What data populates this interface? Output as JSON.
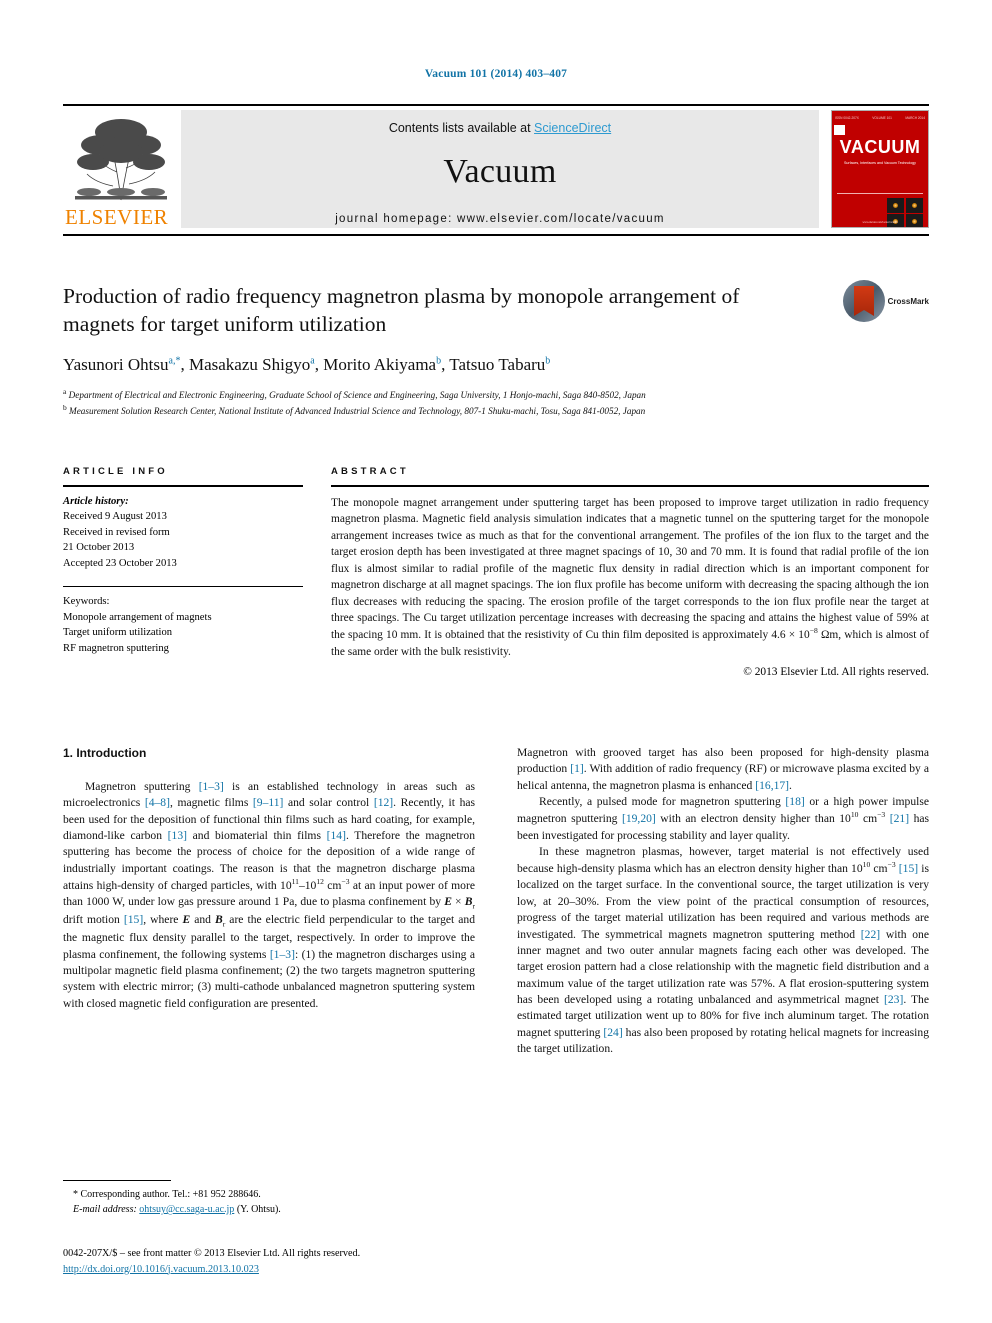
{
  "running_head": "Vacuum 101 (2014) 403–407",
  "masthead": {
    "contents_prefix": "Contents lists available at ",
    "sciencedirect": "ScienceDirect",
    "journal_name": "Vacuum",
    "homepage": "journal homepage: www.elsevier.com/locate/vacuum",
    "publisher_logo_text": "ELSEVIER",
    "cover": {
      "title": "VACUUM",
      "subtitle": "Surfaces, Interfaces and Vacuum Technology",
      "top_left": "ISSN 0042-207X",
      "top_mid": "VOLUME 101",
      "top_right": "MARCH 2014",
      "bottom": "www.elsevier.com/locate/vacuum"
    }
  },
  "article": {
    "title": "Production of radio frequency magnetron plasma by monopole arrangement of magnets for target uniform utilization",
    "crossmark_label": "CrossMark",
    "authors_html": "Yasunori Ohtsu<sup>a,*</sup>, Masakazu Shigyo<sup>a</sup>, Morito Akiyama<sup>b</sup>, Tatsuo Tabaru<sup>b</sup>",
    "affiliation_a": "Department of Electrical and Electronic Engineering, Graduate School of Science and Engineering, Saga University, 1 Honjo-machi, Saga 840-8502, Japan",
    "affiliation_b": "Measurement Solution Research Center, National Institute of Advanced Industrial Science and Technology, 807-1 Shuku-machi, Tosu, Saga 841-0052, Japan"
  },
  "article_info": {
    "heading": "ARTICLE INFO",
    "history_label": "Article history:",
    "received": "Received 9 August 2013",
    "revised_label": "Received in revised form",
    "revised_date": "21 October 2013",
    "accepted": "Accepted 23 October 2013",
    "keywords_label": "Keywords:",
    "keywords": [
      "Monopole arrangement of magnets",
      "Target uniform utilization",
      "RF magnetron sputtering"
    ]
  },
  "abstract": {
    "heading": "ABSTRACT",
    "text_html": "The monopole magnet arrangement under sputtering target has been proposed to improve target utilization in radio frequency magnetron plasma. Magnetic field analysis simulation indicates that a magnetic tunnel on the sputtering target for the monopole arrangement increases twice as much as that for the conventional arrangement. The profiles of the ion flux to the target and the target erosion depth has been investigated at three magnet spacings of 10, 30 and 70 mm. It is found that radial profile of the ion flux is almost similar to radial profile of the magnetic flux density in radial direction which is an important component for magnetron discharge at all magnet spacings. The ion flux profile has become uniform with decreasing the spacing although the ion flux decreases with reducing the spacing. The erosion profile of the target corresponds to the ion flux profile near the target at three spacings. The Cu target utilization percentage increases with decreasing the spacing and attains the highest value of 59% at the spacing 10 mm. It is obtained that the resistivity of Cu thin film deposited is approximately 4.6 &times; 10<sup class=\"sm\">&minus;8</sup> &Omega;m, which is almost of the same order with the bulk resistivity.",
    "copyright": "© 2013 Elsevier Ltd. All rights reserved."
  },
  "body": {
    "section_title": "1. Introduction",
    "left_paragraphs_html": [
      "Magnetron sputtering <span class=\"ref\">[1&ndash;3]</span> is an established technology in areas such as microelectronics <span class=\"ref\">[4&ndash;8]</span>, magnetic films <span class=\"ref\">[9&ndash;11]</span> and solar control <span class=\"ref\">[12]</span>. Recently, it has been used for the deposition of functional thin films such as hard coating, for example, diamond-like carbon <span class=\"ref\">[13]</span> and biomaterial thin films <span class=\"ref\">[14]</span>. Therefore the magnetron sputtering has become the process of choice for the deposition of a wide range of industrially important coatings. The reason is that the magnetron discharge plasma attains high-density of charged particles, with 10<sup class=\"sm\">11</sup>&ndash;10<sup class=\"sm\">12</sup> cm<sup class=\"sm\">&minus;3</sup> at an input power of more than 1000 W, under low gas pressure around 1 Pa, due to plasma confinement by <span class=\"bi\">E</span> &times; <span class=\"bi\">B</span><sub class=\"sm\">r</sub> drift motion <span class=\"ref\">[15]</span>, where <span class=\"bi\">E</span> and <span class=\"bi\">B</span><sub class=\"sm\">r</sub> are the electric field perpendicular to the target and the magnetic flux density parallel to the target, respectively. In order to improve the plasma confinement, the following systems <span class=\"ref\">[1&ndash;3]</span>: (1) the magnetron discharges using a multipolar magnetic field plasma confinement; (2) the two targets magnetron sputtering system with electric mirror; (3) multi-cathode unbalanced magnetron sputtering system with closed magnetic field configuration are presented."
    ],
    "right_paragraphs_html": [
      "Magnetron with grooved target has also been proposed for high-density plasma production <span class=\"ref\">[1]</span>. With addition of radio frequency (RF) or microwave plasma excited by a helical antenna, the magnetron plasma is enhanced <span class=\"ref\">[16,17]</span>.",
      "Recently, a pulsed mode for magnetron sputtering <span class=\"ref\">[18]</span> or a high power impulse magnetron sputtering <span class=\"ref\">[19,20]</span> with an electron density higher than 10<sup class=\"sm\">10</sup> cm<sup class=\"sm\">&minus;3</sup> <span class=\"ref\">[21]</span> has been investigated for processing stability and layer quality.",
      "In these magnetron plasmas, however, target material is not effectively used because high-density plasma which has an electron density higher than 10<sup class=\"sm\">10</sup> cm<sup class=\"sm\">&minus;3</sup> <span class=\"ref\">[15]</span> is localized on the target surface. In the conventional source, the target utilization is very low, at 20&ndash;30%. From the view point of the practical consumption of resources, progress of the target material utilization has been required and various methods are investigated. The symmetrical magnets magnetron sputtering method <span class=\"ref\">[22]</span> with one inner magnet and two outer annular magnets facing each other was developed. The target erosion pattern had a close relationship with the magnetic field distribution and a maximum value of the target utilization rate was 57%. A flat erosion-sputtering system has been developed using a rotating unbalanced and asymmetrical magnet <span class=\"ref\">[23]</span>. The estimated target utilization went up to 80% for five inch aluminum target. The rotation magnet sputtering <span class=\"ref\">[24]</span> has also been proposed by rotating helical magnets for increasing the target utilization."
    ]
  },
  "footnotes": {
    "corresponding_html": "* Corresponding author. Tel.: +81 952 288646.",
    "email_label": "E-mail address:",
    "email": "ohtsuy@cc.saga-u.ac.jp",
    "email_suffix": "(Y. Ohtsu).",
    "frontmatter": "0042-207X/$ – see front matter © 2013 Elsevier Ltd. All rights reserved.",
    "doi": "http://dx.doi.org/10.1016/j.vacuum.2013.10.023"
  },
  "colors": {
    "link": "#1173a6",
    "sciencedirect": "#2e9ad0",
    "elsevier_orange": "#ef8200",
    "cover_red": "#c00000"
  }
}
